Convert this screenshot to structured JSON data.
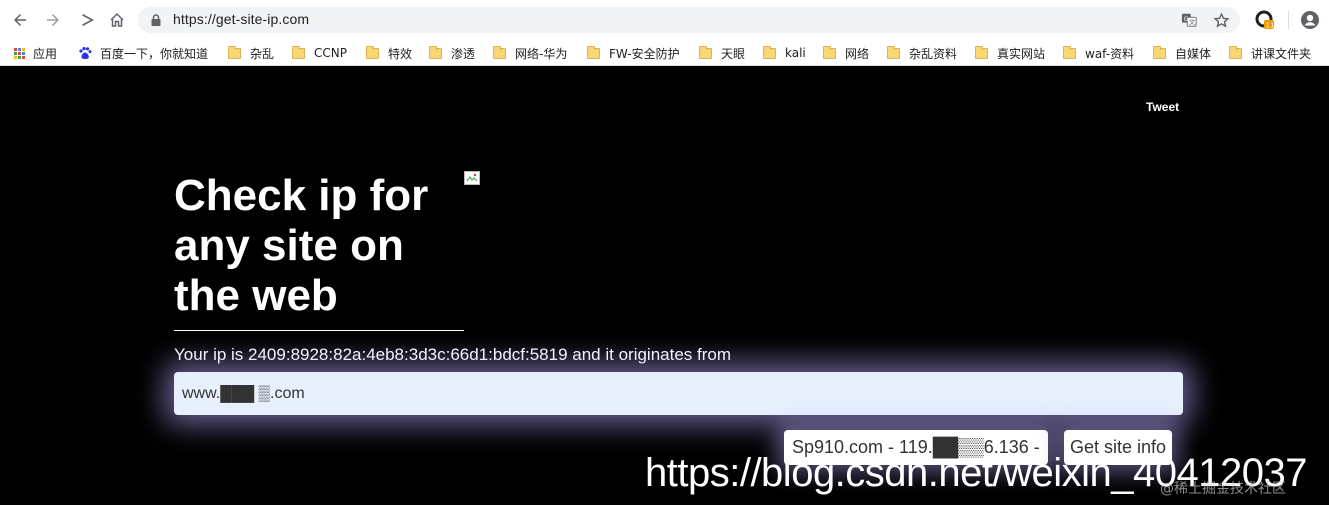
{
  "browser": {
    "url": "https://get-site-ip.com",
    "icons": [
      "back-arrow-icon",
      "forward-arrow-icon",
      "stop-loading-icon",
      "home-icon",
      "lock-icon",
      "translate-icon",
      "star-icon",
      "extension-icon",
      "profile-icon"
    ],
    "extension_badge": "11"
  },
  "bookmarks": [
    {
      "label": "应用",
      "icon": "apps-icon"
    },
    {
      "label": "百度一下，你就知道",
      "icon": "baidu-paw-icon"
    },
    {
      "label": "杂乱",
      "icon": "folder-icon"
    },
    {
      "label": "CCNP",
      "icon": "folder-icon"
    },
    {
      "label": "特效",
      "icon": "folder-icon"
    },
    {
      "label": "渗透",
      "icon": "folder-icon"
    },
    {
      "label": "网络-华为",
      "icon": "folder-icon"
    },
    {
      "label": "FW-安全防护",
      "icon": "folder-icon"
    },
    {
      "label": "天眼",
      "icon": "folder-icon"
    },
    {
      "label": "kali",
      "icon": "folder-icon"
    },
    {
      "label": "网络",
      "icon": "folder-icon"
    },
    {
      "label": "杂乱资料",
      "icon": "folder-icon"
    },
    {
      "label": "真实网站",
      "icon": "folder-icon"
    },
    {
      "label": "waf-资料",
      "icon": "folder-icon"
    },
    {
      "label": "自媒体",
      "icon": "folder-icon"
    },
    {
      "label": "讲课文件夹",
      "icon": "folder-icon"
    }
  ],
  "page": {
    "tweet": "Tweet",
    "headline_1": "Check ip for",
    "headline_2": "any site on",
    "headline_3": "the web",
    "ip_line": "Your ip is 2409:8928:82a:4eb8:3d3c:66d1:bdcf:5819 and it originates from",
    "site_value": "www.███ ▒.com",
    "result": "Sp910.com - 119.██▒▒6.136 -",
    "button": "Get site info"
  },
  "overlay": {
    "watermark": "https://blog.csdn.net/weixin_40412037",
    "watermark_small": "@稀土掘金技术社区"
  },
  "colors": {
    "page_bg": "#000000",
    "input_bg": "#e8f0fe",
    "glow": "#b9aaff",
    "folder": "#f8d775"
  }
}
